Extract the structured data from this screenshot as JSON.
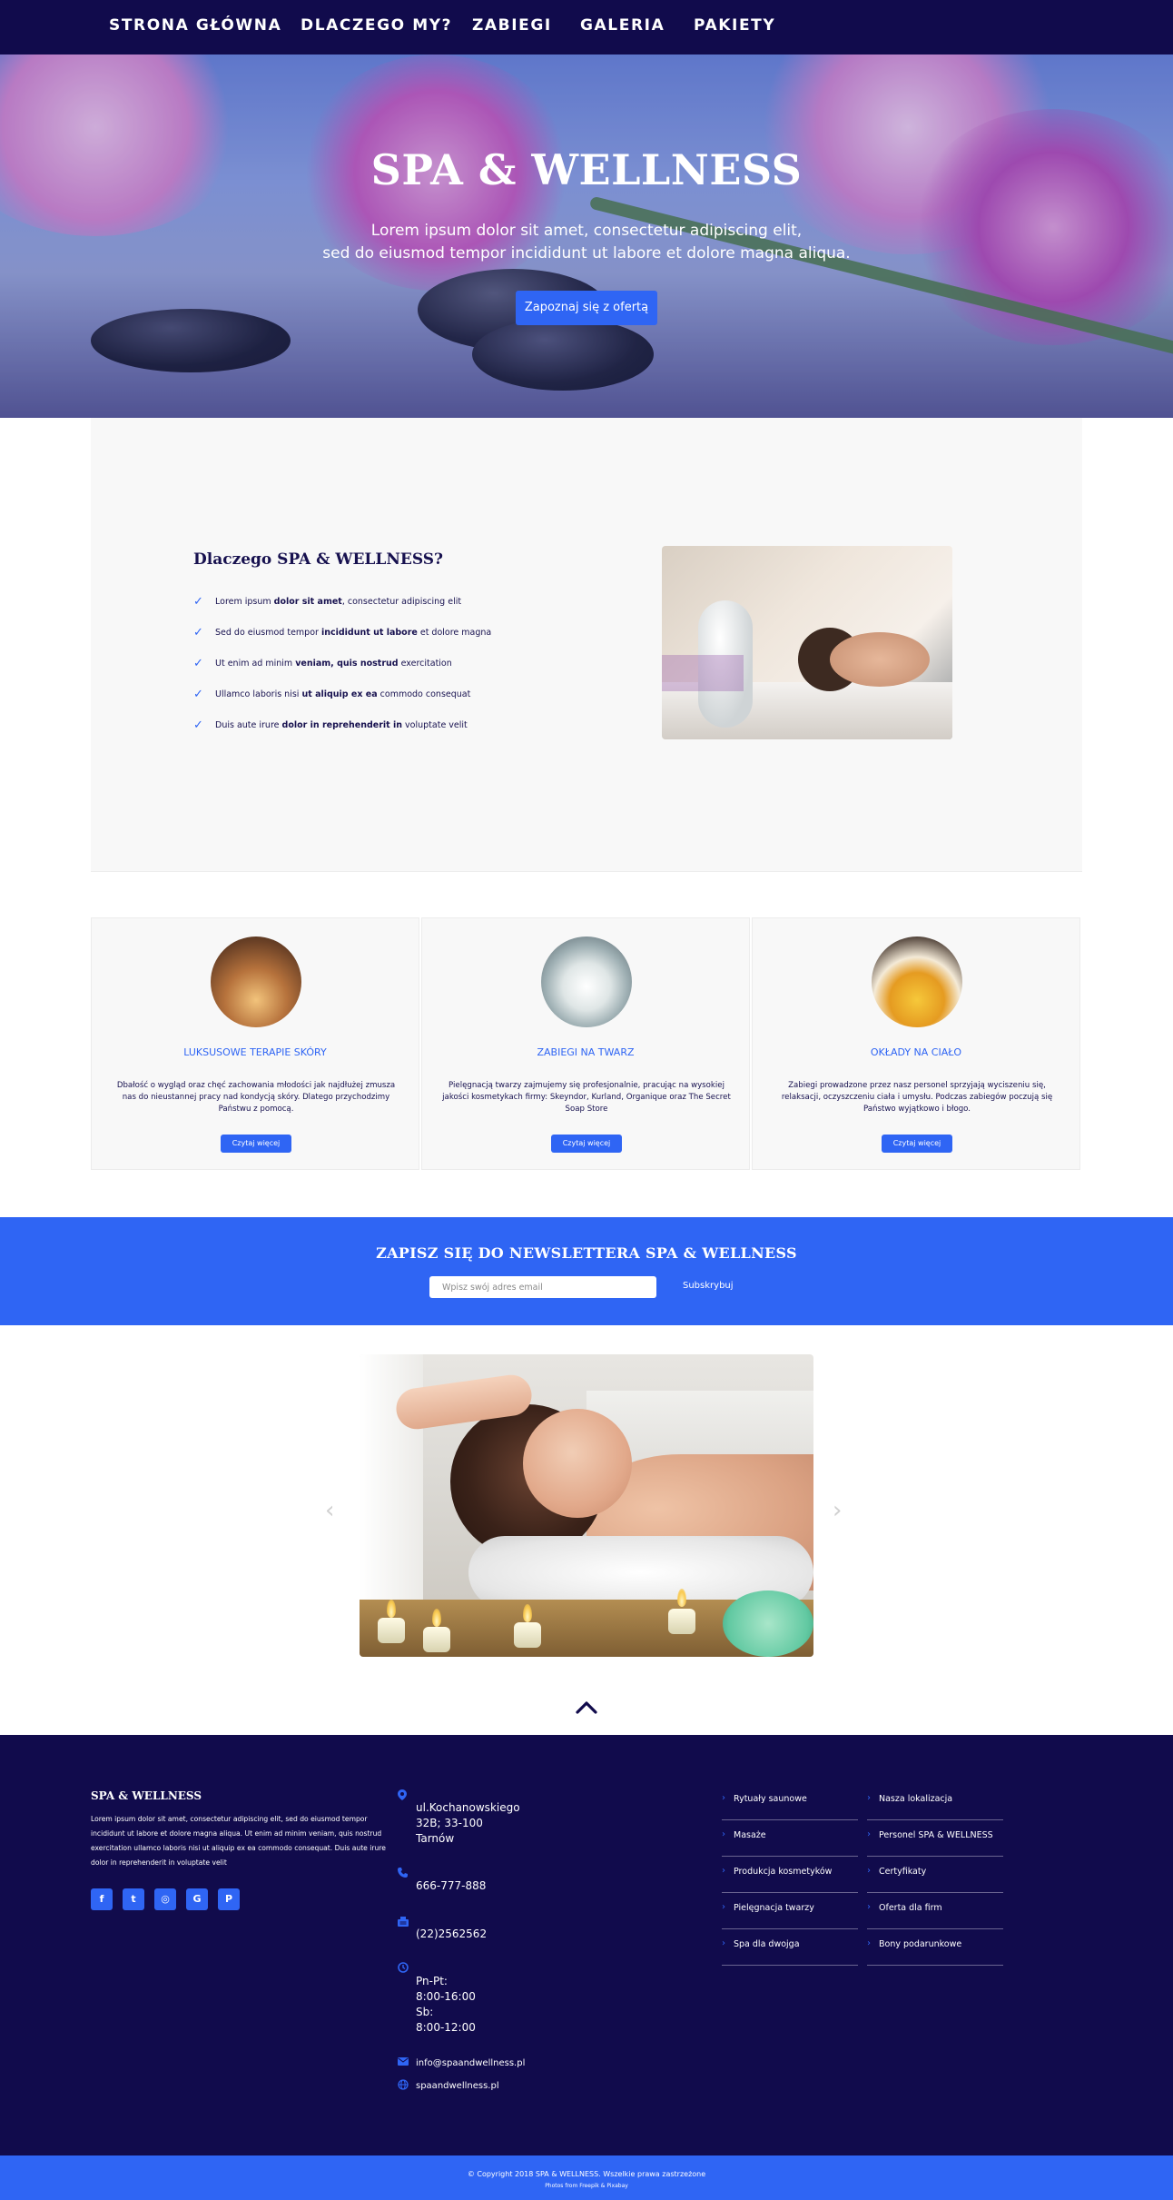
{
  "nav": {
    "items": [
      "STRONA GŁÓWNA",
      "DLACZEGO MY?",
      "ZABIEGI",
      "GALERIA",
      "PAKIETY"
    ]
  },
  "hero": {
    "title": "SPA & WELLNESS",
    "subtitle_line1": "Lorem ipsum dolor sit amet, consectetur adipiscing elit,",
    "subtitle_line2": "sed do eiusmod tempor incididunt ut labore et dolore magna aliqua.",
    "button": "Zapoznaj się z ofertą"
  },
  "why": {
    "title": "Dlaczego SPA & WELLNESS?",
    "items": [
      {
        "pre": "Lorem ipsum ",
        "bold": "dolor sit amet",
        "post": ", consectetur adipiscing elit"
      },
      {
        "pre": "Sed do eiusmod tempor ",
        "bold": "incididunt ut labore",
        "post": " et dolore magna"
      },
      {
        "pre": "Ut enim ad minim ",
        "bold": "veniam, quis nostrud",
        "post": " exercitation"
      },
      {
        "pre": "Ullamco laboris nisi ",
        "bold": "ut aliquip ex ea",
        "post": " commodo consequat"
      },
      {
        "pre": "Duis aute irure ",
        "bold": "dolor in reprehenderit in",
        "post": " voluptate velit"
      }
    ]
  },
  "cards": [
    {
      "title": "LUKSUSOWE TERAPIE SKÓRY",
      "text": "Dbałość o wygląd oraz chęć zachowania młodości jak najdłużej zmusza nas do nieustannej pracy nad kondycją skóry. Dlatego przychodzimy Państwu z pomocą.",
      "button": "Czytaj więcej"
    },
    {
      "title": "ZABIEGI NA TWARZ",
      "text": "Pielęgnacją twarzy zajmujemy się profesjonalnie, pracując na wysokiej jakości kosmetykach firmy: Skeyndor, Kurland, Organique oraz The Secret Soap Store",
      "button": "Czytaj więcej"
    },
    {
      "title": "OKŁADY NA CIAŁO",
      "text": "Zabiegi prowadzone przez nasz personel sprzyjają wyciszeniu się, relaksacji, oczyszczeniu ciała i umysłu. Podczas zabiegów poczują się Państwo wyjątkowo i błogo.",
      "button": "Czytaj więcej"
    }
  ],
  "newsletter": {
    "title": "ZAPISZ SIĘ DO NEWSLETTERA SPA & WELLNESS",
    "placeholder": "Wpisz swój adres email",
    "button": "Subskrybuj"
  },
  "slider": {
    "prev": "‹",
    "next": "›"
  },
  "footer": {
    "brand": "SPA & WELLNESS",
    "text": "Lorem ipsum dolor sit amet, consectetur adipiscing elit, sed do eiusmod tempor incididunt ut labore et dolore magna aliqua. Ut enim ad minim veniam, quis nostrud exercitation ullamco laboris nisi ut aliquip ex ea commodo consequat. Duis aute irure dolor in reprehenderit in voluptate velit",
    "social": [
      "f",
      "t",
      "◎",
      "G",
      "P"
    ],
    "contact": {
      "address_line1": "ul.Kochanowskiego",
      "address_line2": "32B; 33-100",
      "address_line3": "Tarnów",
      "phone": "666-777-888",
      "fax": "(22)2562562",
      "hours_line1": "Pn-Pt:",
      "hours_line2": "8:00-16:00",
      "hours_line3": "Sb:",
      "hours_line4": "8:00-12:00",
      "email": "info@spaandwellness.pl",
      "website": "spaandwellness.pl"
    },
    "links_col1": [
      "Rytuały saunowe",
      "Masaże",
      "Produkcja kosmetyków",
      "Pielęgnacja twarzy",
      "Spa dla dwojga"
    ],
    "links_col2": [
      "Nasza lokalizacja",
      "Personel SPA & WELLNESS",
      "Certyfikaty",
      "Oferta dla firm",
      "Bony podarunkowe"
    ]
  },
  "bottom": {
    "copyright": "© Copyright 2018 SPA & WELLNESS. Wszelkie prawa zastrzeżone",
    "credits": "Photos from Freepik & Pixabay"
  },
  "colors": {
    "navy": "#110b4c",
    "accent": "#2f65f4",
    "light_bg": "#f8f8f8"
  }
}
